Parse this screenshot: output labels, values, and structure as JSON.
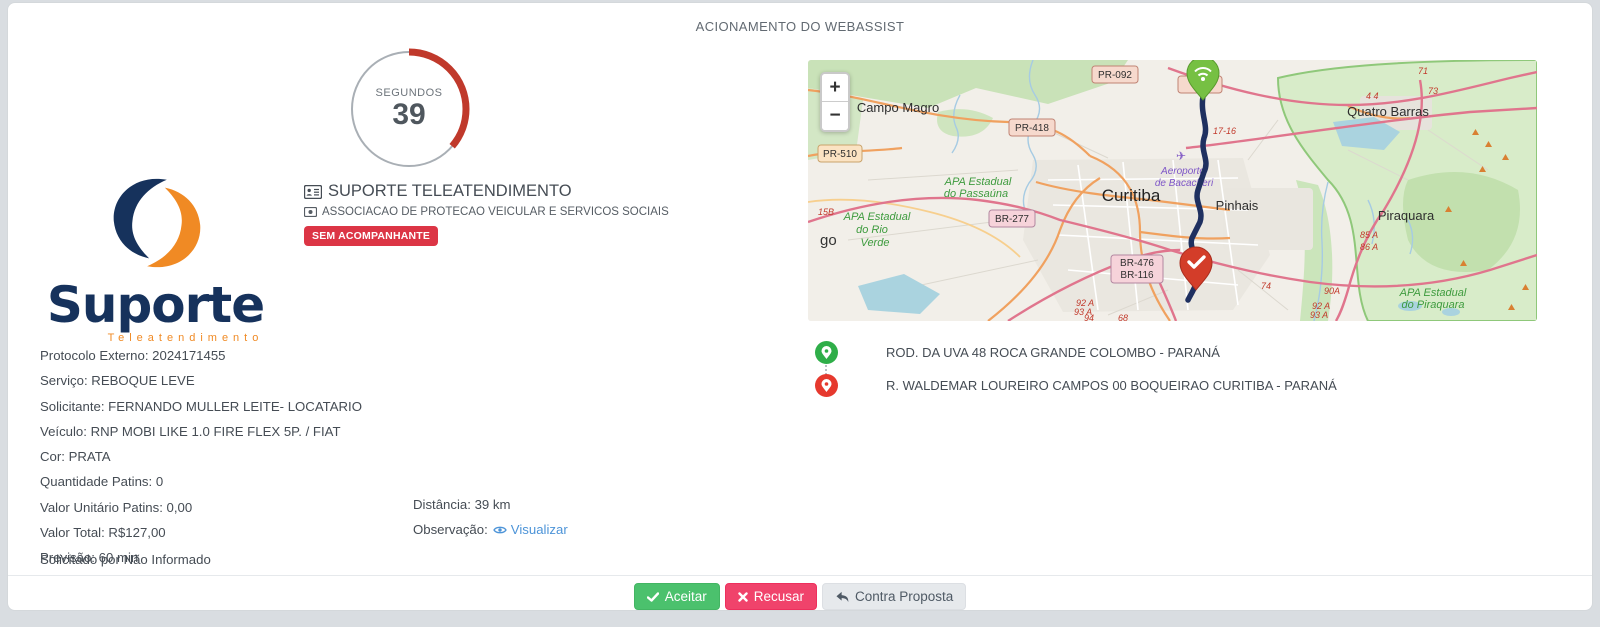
{
  "title": "ACIONAMENTO DO WEBASSIST",
  "timer": {
    "unit_label": "SEGUNDOS",
    "value": "39"
  },
  "logo": {
    "wordmark": "Suporte",
    "tagline": "Teleatendimento"
  },
  "provider": {
    "name": "SUPORTE TELEATENDIMENTO",
    "association": "ASSOCIACAO DE PROTECAO VEICULAR E SERVICOS SOCIAIS",
    "badge": "SEM ACOMPANHANTE"
  },
  "details": {
    "rows": [
      "Protocolo Externo: 2024171455",
      "Serviço: REBOQUE LEVE",
      "Solicitante: FERNANDO MULLER LEITE- LOCATARIO",
      "Veículo: RNP MOBI LIKE 1.0 FIRE FLEX 5P. / FIAT",
      "Cor: PRATA",
      "Quantidade Patins: 0",
      "Valor Unitário Patins: 0,00",
      "Valor Total: R$127,00",
      "Previsão: 60 min"
    ],
    "solicited_by": "Solicitado por Não Informado"
  },
  "metrics": {
    "distance": "Distância: 39 km",
    "observation_label": "Observação:",
    "observation_link": "Visualizar"
  },
  "route": {
    "origin": "ROD. DA UVA 48 ROCA GRANDE COLOMBO - PARANÁ",
    "destination": "R. WALDEMAR LOUREIRO CAMPOS 00 BOQUEIRAO CURITIBA - PARANÁ"
  },
  "map": {
    "zoom_in": "+",
    "zoom_out": "−",
    "cities": {
      "campo_magro": "Campo Magro",
      "curitiba": "Curitiba",
      "pinhais": "Pinhais",
      "quatro_barras": "Quatro Barras",
      "piraquara": "Piraquara",
      "partial_west": "go"
    },
    "parks": {
      "passauna_1": "APA Estadual",
      "passauna_2": "do Passaúna",
      "rio_verde_1": "APA Estadual",
      "rio_verde_2": "do Rio",
      "rio_verde_3": "Verde",
      "piraquara_1": "APA Estadual",
      "piraquara_2": "do Piraquara"
    },
    "airport_1": "Aeroporto",
    "airport_2": "de Bacacheri",
    "badges": {
      "pr092": "PR-092",
      "pr418": "PR-418",
      "pr510": "PR-510",
      "br277": "BR-277",
      "br476": "BR-476",
      "br116": "BR-116"
    },
    "road_numbers": {
      "n1716": "17-16",
      "n71": "71",
      "n73": "73",
      "n44": "4 4",
      "n74": "74",
      "n85a": "85 A",
      "n86a": "86 A",
      "n90a": "90A",
      "n92a": "92 A",
      "n93a": "93 A",
      "n94": "94",
      "n68": "68",
      "n15b": "15B"
    }
  },
  "actions": {
    "accept": "Aceitar",
    "refuse": "Recusar",
    "counter": "Contra Proposta"
  },
  "colors": {
    "accent_green": "#4BC16D",
    "accent_red": "#F0436B",
    "badge_red": "#DC3545",
    "timer_arc": "#C0392B",
    "link_blue": "#4D94D8",
    "route_navy": "#1F3060",
    "marker_green": "#76C043",
    "marker_red": "#D33D29"
  }
}
